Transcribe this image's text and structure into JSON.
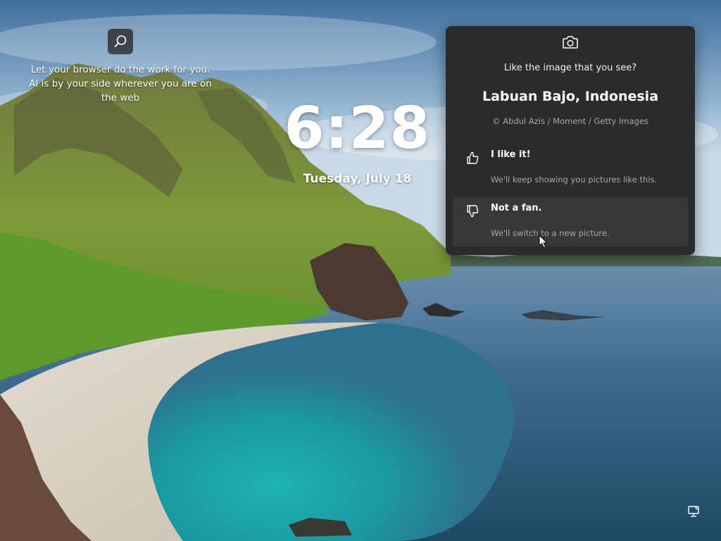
{
  "spotlight": {
    "search_icon": "search-icon",
    "promo_line1": "Let your browser do the work for you.",
    "promo_line2": "AI is by your side wherever you are on",
    "promo_line3": "the web"
  },
  "clock": {
    "time": "6:28",
    "date": "Tuesday, July 18"
  },
  "flyout": {
    "camera_icon": "camera-icon",
    "question": "Like the image that you see?",
    "location": "Labuan Bajo, Indonesia",
    "credit": "© Abdul Azis / Moment / Getty Images",
    "options": [
      {
        "icon": "thumbs-up-icon",
        "title": "I like it!",
        "description": "We'll keep showing you pictures like this."
      },
      {
        "icon": "thumbs-down-icon",
        "title": "Not a fan.",
        "description": "We'll switch to a new picture."
      }
    ]
  },
  "tray": {
    "network_icon": "network-icon"
  },
  "colors": {
    "flyout_bg": "#2b2b2b",
    "option_hover_bg": "#383838",
    "secondary_text": "#a8a8a8"
  }
}
